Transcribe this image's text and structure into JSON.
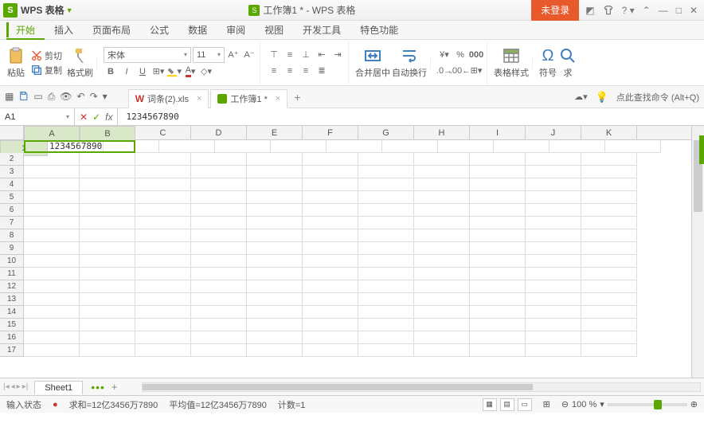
{
  "app": {
    "name": "WPS 表格",
    "badge": "S"
  },
  "title": {
    "doc": "工作簿1 *",
    "suffix": " - WPS 表格"
  },
  "login": "未登录",
  "menu": [
    "开始",
    "插入",
    "页面布局",
    "公式",
    "数据",
    "审阅",
    "视图",
    "开发工具",
    "特色功能"
  ],
  "ribbon": {
    "paste": "粘贴",
    "cut": "剪切",
    "copy": "复制",
    "brush": "格式刷",
    "font": "宋体",
    "size": "11",
    "merge": "合并居中",
    "wrap": "自动换行",
    "tablestyle": "表格样式",
    "symbol": "符号",
    "find": "求"
  },
  "doctabs": [
    {
      "name": "词条(2).xls",
      "type": "w"
    },
    {
      "name": "工作簿1 *",
      "type": "s"
    }
  ],
  "cmdhint": "点此查找命令 (Alt+Q)",
  "namebox": "A1",
  "formula": "1234567890",
  "cols": [
    "A",
    "B",
    "C",
    "D",
    "E",
    "F",
    "G",
    "H",
    "I",
    "J",
    "K"
  ],
  "rowcount": 17,
  "cells": {
    "A1": "1234567890"
  },
  "sheet": "Sheet1",
  "status": {
    "mode": "输入状态",
    "sum": "求和=12亿3456万7890",
    "avg": "平均值=12亿3456万7890",
    "count": "计数=1",
    "zoom": "100 %"
  }
}
